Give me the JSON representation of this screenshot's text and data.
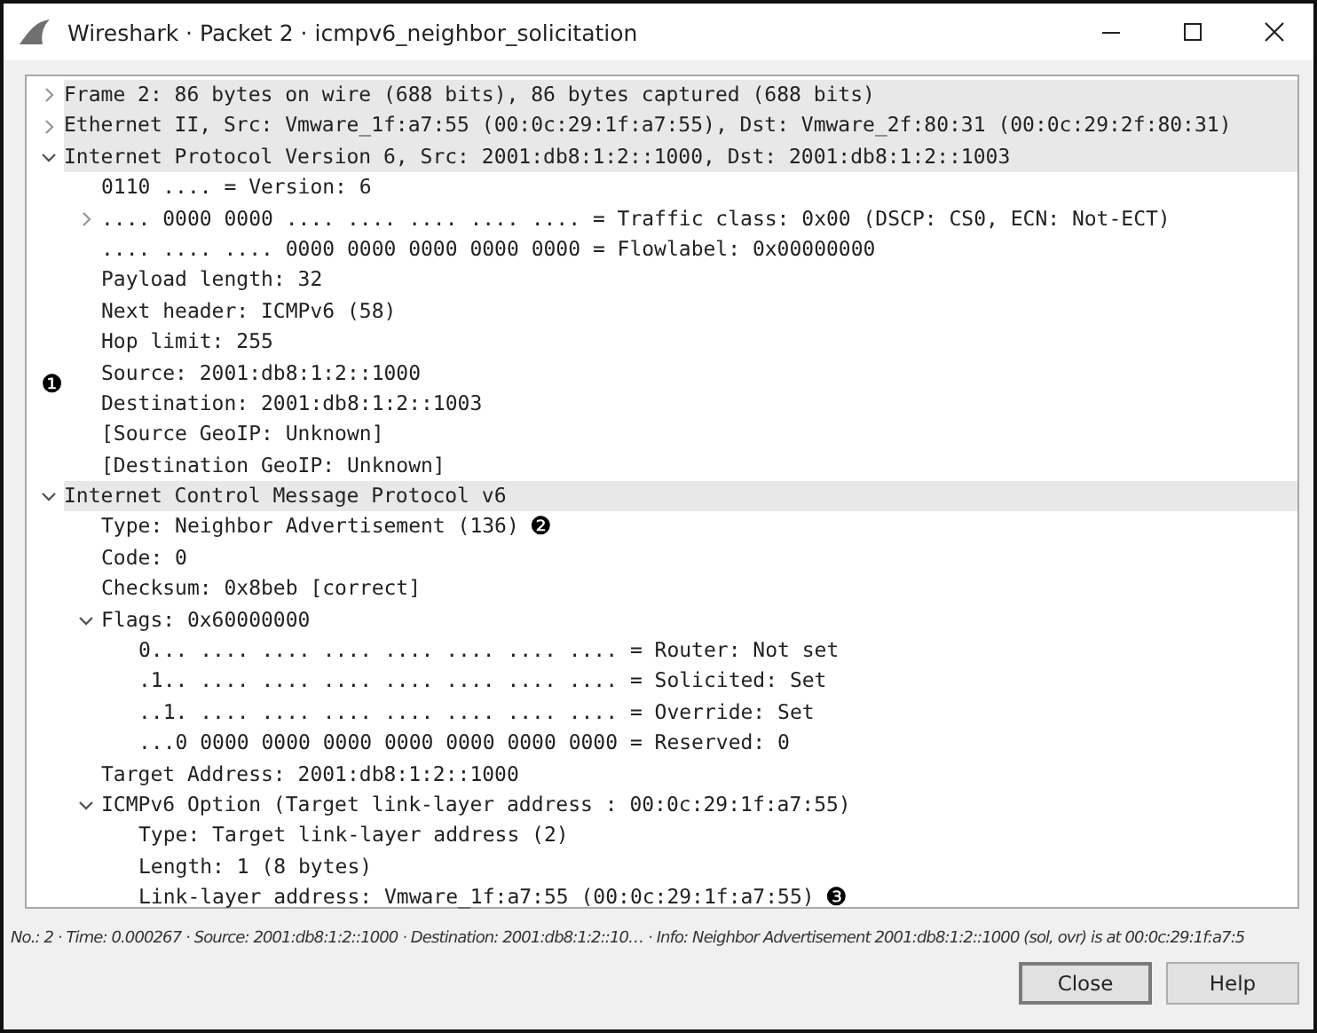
{
  "window": {
    "title": "Wireshark · Packet 2 · icmpv6_neighbor_solicitation"
  },
  "tree": [
    {
      "text": "Frame 2: 86 bytes on wire (688 bits), 86 bytes captured (688 bits)",
      "expanded": false
    },
    {
      "text": "Ethernet II, Src: Vmware_1f:a7:55 (00:0c:29:1f:a7:55), Dst: Vmware_2f:80:31 (00:0c:29:2f:80:31)",
      "expanded": false
    },
    {
      "text": "Internet Protocol Version 6, Src: 2001:db8:1:2::1000, Dst: 2001:db8:1:2::1003",
      "expanded": true,
      "children": [
        {
          "text": "0110 .... = Version: 6"
        },
        {
          "text": ".... 0000 0000 .... .... .... .... .... = Traffic class: 0x00 (DSCP: CS0, ECN: Not-ECT)",
          "expanded": false
        },
        {
          "text": ".... .... .... 0000 0000 0000 0000 0000 = Flowlabel: 0x00000000"
        },
        {
          "text": "Payload length: 32"
        },
        {
          "text": "Next header: ICMPv6 (58)"
        },
        {
          "text": "Hop limit: 255"
        },
        {
          "text": "Source: 2001:db8:1:2::1000",
          "callout": "❶",
          "kind": "margin_callout"
        },
        {
          "text": "Destination: 2001:db8:1:2::1003"
        },
        {
          "text": "[Source GeoIP: Unknown]"
        },
        {
          "text": "[Destination GeoIP: Unknown]"
        }
      ]
    },
    {
      "text": "Internet Control Message Protocol v6",
      "expanded": true,
      "children": [
        {
          "text": "Type: Neighbor Advertisement (136)",
          "callout": "❷",
          "kind": "inline_callout"
        },
        {
          "text": "Code: 0"
        },
        {
          "text": "Checksum: 0x8beb [correct]"
        },
        {
          "text": "Flags: 0x60000000",
          "expanded": true,
          "children": [
            {
              "text": "0... .... .... .... .... .... .... .... = Router: Not set"
            },
            {
              "text": ".1.. .... .... .... .... .... .... .... = Solicited: Set"
            },
            {
              "text": "..1. .... .... .... .... .... .... .... = Override: Set"
            },
            {
              "text": "...0 0000 0000 0000 0000 0000 0000 0000 = Reserved: 0"
            }
          ]
        },
        {
          "text": "Target Address: 2001:db8:1:2::1000"
        },
        {
          "text": "ICMPv6 Option (Target link-layer address : 00:0c:29:1f:a7:55)",
          "expanded": true,
          "children": [
            {
              "text": "Type: Target link-layer address (2)"
            },
            {
              "text": "Length: 1 (8 bytes)"
            },
            {
              "text": "Link-layer address: Vmware_1f:a7:55 (00:0c:29:1f:a7:55)",
              "callout": "❸",
              "kind": "inline_callout"
            }
          ]
        }
      ]
    }
  ],
  "status_line": "No.: 2 · Time: 0.000267 · Source: 2001:db8:1:2::1000 · Destination: 2001:db8:1:2::10… · Info: Neighbor Advertisement 2001:db8:1:2::1000 (sol, ovr) is at 00:0c:29:1f:a7:5",
  "buttons": [
    {
      "label": "Close",
      "default": true
    },
    {
      "label": "Help",
      "default": false
    }
  ]
}
